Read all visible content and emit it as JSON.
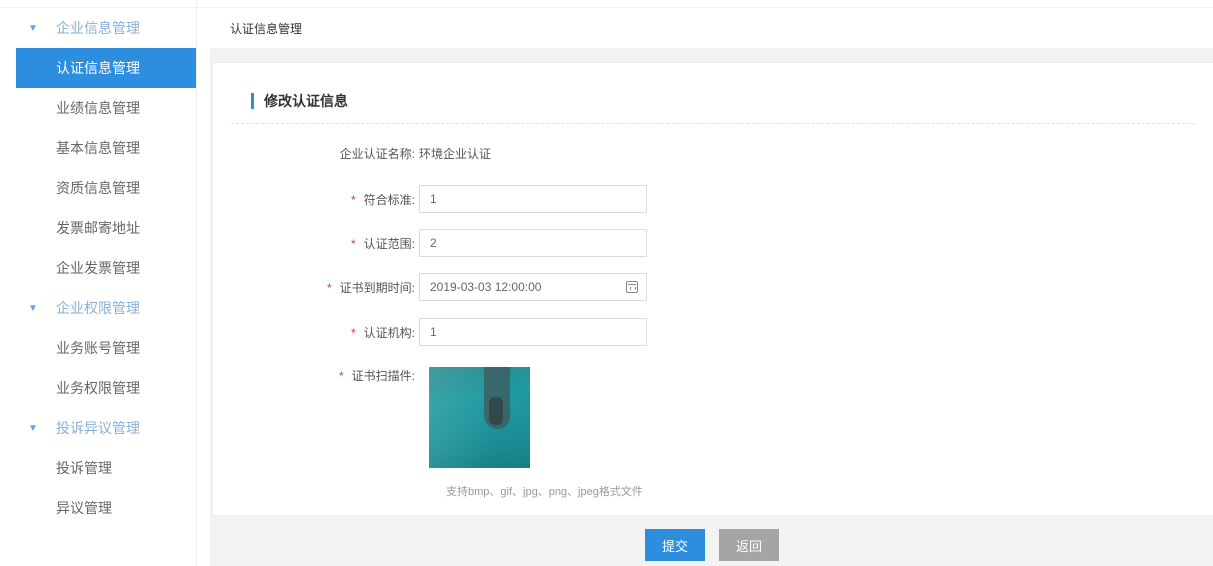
{
  "sidebar": {
    "groups": [
      {
        "label": "企业信息管理",
        "items": [
          "认证信息管理",
          "业绩信息管理",
          "基本信息管理",
          "资质信息管理",
          "发票邮寄地址",
          "企业发票管理"
        ]
      },
      {
        "label": "企业权限管理",
        "items": [
          "业务账号管理",
          "业务权限管理"
        ]
      },
      {
        "label": "投诉异议管理",
        "items": [
          "投诉管理",
          "异议管理"
        ]
      }
    ],
    "active_item": "认证信息管理",
    "accent_color": "#2d8ee0"
  },
  "breadcrumb": "认证信息管理",
  "form": {
    "title": "修改认证信息",
    "company_cert_name": {
      "label": "企业认证名称:",
      "value": "环境企业认证"
    },
    "standard": {
      "label": "符合标准:",
      "value": "1"
    },
    "scope": {
      "label": "认证范围:",
      "value": "2"
    },
    "expiry": {
      "label": "证书到期时间:",
      "value": "2019-03-03 12:00:00"
    },
    "agency": {
      "label": "认证机构:",
      "value": "1"
    },
    "scan": {
      "label": "证书扫描件:",
      "hint": "支持bmp、gif、jpg、png、jpeg格式文件"
    },
    "required_mark": "*"
  },
  "buttons": {
    "submit": "提交",
    "back": "返回"
  }
}
